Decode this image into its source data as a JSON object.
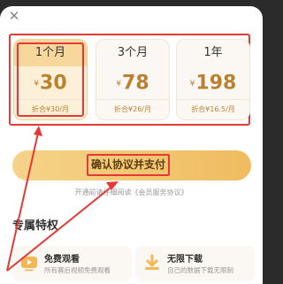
{
  "dialog": {
    "close_icon": "close-icon"
  },
  "plans": [
    {
      "period": "1个月",
      "currency": "¥",
      "price": "30",
      "per_month": "折合¥30/月",
      "selected": true
    },
    {
      "period": "3个月",
      "currency": "¥",
      "price": "78",
      "per_month": "折合¥26/月",
      "selected": false
    },
    {
      "period": "1年",
      "currency": "¥",
      "price": "198",
      "per_month": "折合¥16.5/月",
      "selected": false
    }
  ],
  "pay_button": {
    "label": "确认协议并支付"
  },
  "agreement": {
    "prefix": "开通前请仔细阅读",
    "link": "《会员服务协议》"
  },
  "privileges": {
    "title": "专属特权",
    "items": [
      {
        "title": "免费观看",
        "desc": "所有赛后视频免费观看",
        "icon": "play-video-icon"
      },
      {
        "title": "无限下载",
        "desc": "自己的数据下载无限制",
        "icon": "download-icon"
      }
    ]
  },
  "colors": {
    "accent_gold": "#b98232",
    "annotation_red": "#e53935",
    "button_gold": "#efbc5e"
  }
}
